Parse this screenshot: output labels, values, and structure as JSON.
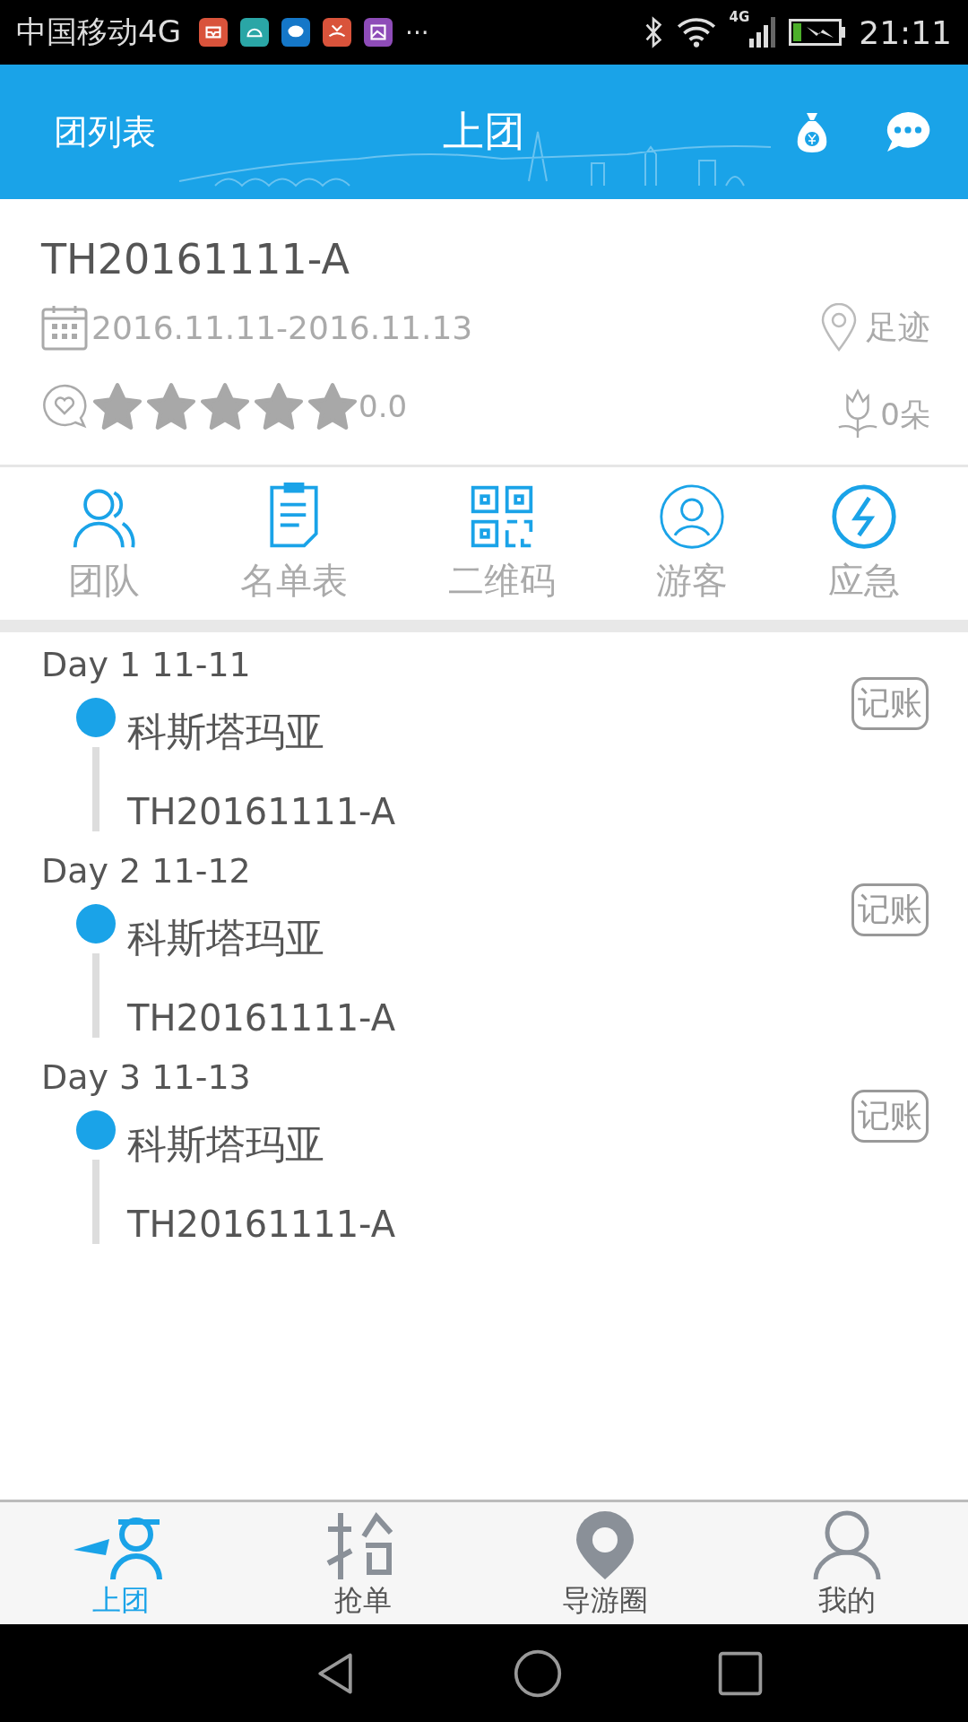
{
  "status_bar": {
    "carrier": "中国移动4G",
    "more": "···",
    "network": "4G",
    "time": "21:11"
  },
  "header": {
    "back_label": "团列表",
    "title": "上团"
  },
  "group": {
    "code": "TH20161111-A",
    "dates": "2016.11.11-2016.11.13",
    "footprint": "足迹",
    "stars": 0,
    "rating": "0.0",
    "flowers": "0朵"
  },
  "shortcuts": [
    {
      "kind": "team",
      "label": "团队"
    },
    {
      "kind": "list",
      "label": "名单表"
    },
    {
      "kind": "qr",
      "label": "二维码"
    },
    {
      "kind": "tourist",
      "label": "游客"
    },
    {
      "kind": "emergency",
      "label": "应急"
    }
  ],
  "days": [
    {
      "day": "Day 1",
      "date": "11-11",
      "place": "科斯塔玛亚",
      "code": "TH20161111-A",
      "action": "记账"
    },
    {
      "day": "Day 2",
      "date": "11-12",
      "place": "科斯塔玛亚",
      "code": "TH20161111-A",
      "action": "记账"
    },
    {
      "day": "Day 3",
      "date": "11-13",
      "place": "科斯塔玛亚",
      "code": "TH20161111-A",
      "action": "记账"
    }
  ],
  "bottom_nav": [
    {
      "kind": "guide",
      "label": "上团",
      "selected": true
    },
    {
      "kind": "grab",
      "label": "抢单",
      "selected": false
    },
    {
      "kind": "circle",
      "label": "导游圈",
      "selected": false
    },
    {
      "kind": "me",
      "label": "我的",
      "selected": false
    }
  ]
}
